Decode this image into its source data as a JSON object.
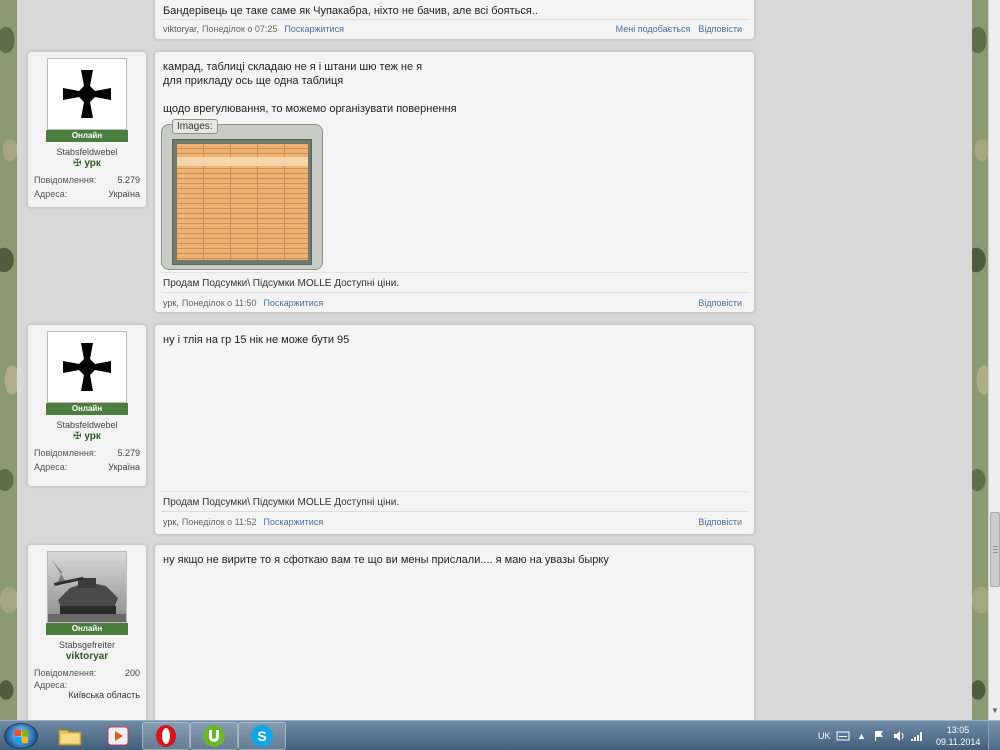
{
  "colors": {
    "online_badge": "#4a7d3e",
    "username": "#2f5a24",
    "link": "#4a6da0",
    "page_background": "#d8d8d8"
  },
  "top_post": {
    "text": "Бандерівець це таке саме як Чупакабра, ніхто не бачив, але всі бояться..",
    "author": "viktoryar,",
    "date": "Понеділок о 07:25",
    "report": "Поскаржитися",
    "like": "Мені подобається",
    "reply": "Відповісти"
  },
  "posts": [
    {
      "user": {
        "avatar_icon": "iron-cross-icon",
        "status": "Онлайн",
        "rank": "Stabsfeldwebel",
        "name": "урк",
        "name_icon": "cross-icon",
        "messages_label": "Повідомлення:",
        "messages": "5.279",
        "address_label": "Адреса:",
        "address": "Україна"
      },
      "text": "камрад, таблиці складаю не я і штани шю теж не я\nдля прикладу ось ще одна таблиця\n\nщодо врегулювання, то можемо організувати повернення",
      "images_label": "Images:",
      "signature": "Продам Подсумки\\ Підсумки MOLLE Доступні ціни.",
      "author": "урк,",
      "date": "Понеділок о 11:50",
      "report": "Поскаржитися",
      "reply": "Відповісти"
    },
    {
      "user": {
        "avatar_icon": "iron-cross-icon",
        "status": "Онлайн",
        "rank": "Stabsfeldwebel",
        "name": "урк",
        "name_icon": "cross-icon",
        "messages_label": "Повідомлення:",
        "messages": "5.279",
        "address_label": "Адреса:",
        "address": "Україна"
      },
      "text": "ну і тлія на гр 15 нік не може бути 95",
      "signature": "Продам Подсумки\\ Підсумки MOLLE Доступні ціни.",
      "author": "урк,",
      "date": "Понеділок о 11:52",
      "report": "Поскаржитися",
      "reply": "Відповісти"
    },
    {
      "user": {
        "avatar_icon": "tank-photo",
        "status": "Онлайн",
        "rank": "Stabsgefreiter",
        "name": "viktoryar",
        "messages_label": "Повідомлення:",
        "messages": "200",
        "address_label": "Адреса:",
        "address": "Київська область"
      },
      "text": "ну якщо не вирите то я сфоткаю вам те що ви мены прислали.... я маю на увазы бырку"
    }
  ],
  "taskbar": {
    "language": "UK",
    "time": "13:05",
    "date": "09.11.2014",
    "apps": [
      "windows-explorer-icon",
      "media-player-icon",
      "opera-icon",
      "utorrent-icon",
      "skype-icon"
    ]
  }
}
